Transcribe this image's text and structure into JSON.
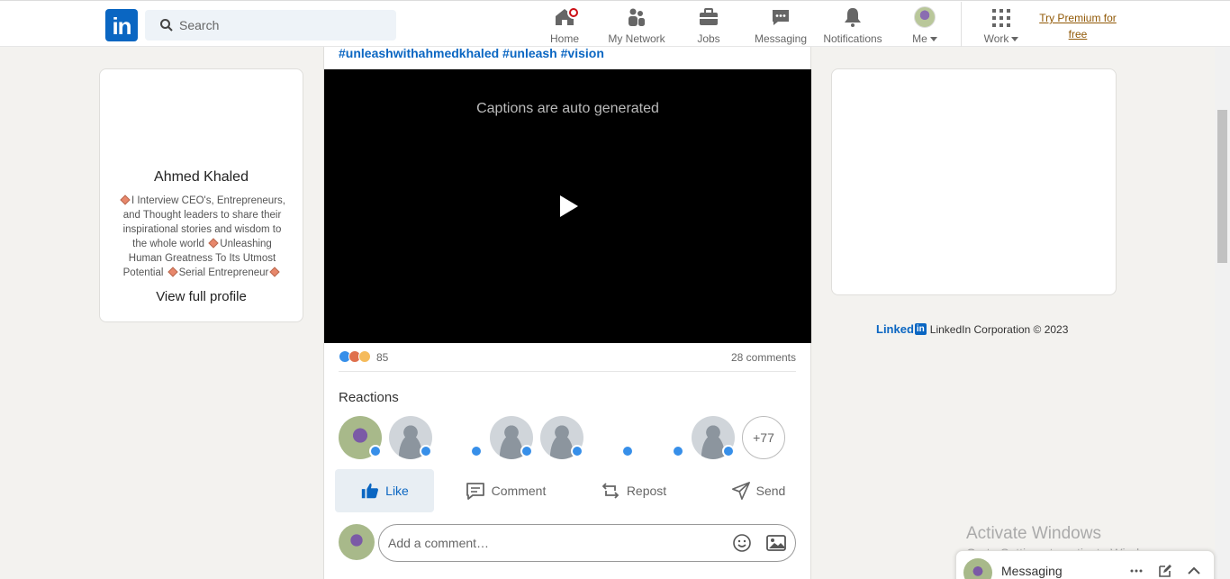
{
  "header": {
    "logo": "in",
    "search_placeholder": "Search",
    "nav": {
      "home": "Home",
      "network": "My Network",
      "jobs": "Jobs",
      "messaging": "Messaging",
      "notifications": "Notifications",
      "me": "Me",
      "work": "Work"
    },
    "premium_line1": "Try Premium for",
    "premium_line2": "free"
  },
  "profile": {
    "name": "Ahmed Khaled",
    "bio_part1": "I Interview CEO's, Entrepreneurs, and Thought leaders to share their inspirational stories and wisdom to the whole world",
    "bio_part2": "Unleashing Human Greatness To Its Utmost Potential",
    "bio_part3": "Serial Entrepreneur",
    "view_full_profile": "View full profile"
  },
  "post": {
    "hashtags": "#unleashwithahmedkhaled #unleash #vision",
    "captions_notice": "Captions are auto generated",
    "reaction_count": "85",
    "comments_count": "28 comments",
    "reactions_title": "Reactions",
    "more_reactors": "+77",
    "actions": {
      "like": "Like",
      "comment": "Comment",
      "repost": "Repost",
      "send": "Send"
    },
    "comment_placeholder": "Add a comment…"
  },
  "footer": {
    "brand": "Linked",
    "brand_box": "in",
    "copyright": "LinkedIn Corporation © 2023"
  },
  "windows": {
    "activate_title": "Activate Windows",
    "activate_sub": "Go to Settings to activate Windows."
  },
  "messaging_bar": {
    "label": "Messaging"
  },
  "colors": {
    "brand_blue": "#0a66c2",
    "notification_badge": "#cc1016",
    "premium_gold": "#915907"
  }
}
